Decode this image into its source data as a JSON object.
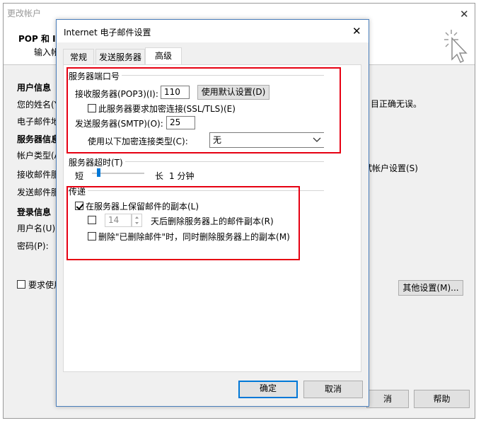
{
  "outer_window": {
    "title": "更改帐户",
    "close_glyph": "✕",
    "header_title": "POP 和 I",
    "header_subtitle": "输入帐",
    "sections": {
      "user_info": "用户信息",
      "your_name": "您的姓名(Y",
      "email": "电子邮件地",
      "server_info": "服务器信息",
      "account_type": "帐户类型(A",
      "incoming": "接收邮件服",
      "outgoing": "发送邮件服",
      "login_info": "登录信息",
      "username": "用户名(U):",
      "password": "密码(P):"
    },
    "right_text_1": "目正确无误。",
    "right_text_2": "试帐户设置(S)",
    "require_checkbox_label": "要求使用",
    "more_settings_button": "其他设置(M)...",
    "bottom_partial_button": "消",
    "help_button": "帮助",
    "icon": "cursor-sparkle-icon"
  },
  "dialog": {
    "title": "Internet 电子邮件设置",
    "close_glyph": "✕",
    "tabs": [
      "常规",
      "发送服务器",
      "高级"
    ],
    "active_tab": 2,
    "server_ports": {
      "section_label": "服务器端口号",
      "pop3_label": "接收服务器(POP3)(I):",
      "pop3_value": "110",
      "default_button": "使用默认设置(D)",
      "ssl_checkbox_label": "此服务器要求加密连接(SSL/TLS)(E)",
      "ssl_checked": false,
      "smtp_label": "发送服务器(SMTP)(O):",
      "smtp_value": "25",
      "encryption_label": "使用以下加密连接类型(C):",
      "encryption_value": "无"
    },
    "timeout": {
      "section_label": "服务器超时(T)",
      "short_label": "短",
      "long_label": "长",
      "value_text": "1 分钟",
      "level": 0.1
    },
    "delivery": {
      "section_label": "传递",
      "keep_copy_label": "在服务器上保留邮件的副本(L)",
      "keep_copy_checked": true,
      "remove_after_days_value": "14",
      "remove_after_label": "天后删除服务器上的邮件副本(R)",
      "remove_after_checked": false,
      "remove_deleted_label": "删除\"已删除邮件\"时，同时删除服务器上的副本(M)",
      "remove_deleted_checked": false
    },
    "ok_button": "确定",
    "cancel_button": "取消"
  },
  "colors": {
    "highlight_box": "#e60012",
    "accent": "#0078d7"
  }
}
